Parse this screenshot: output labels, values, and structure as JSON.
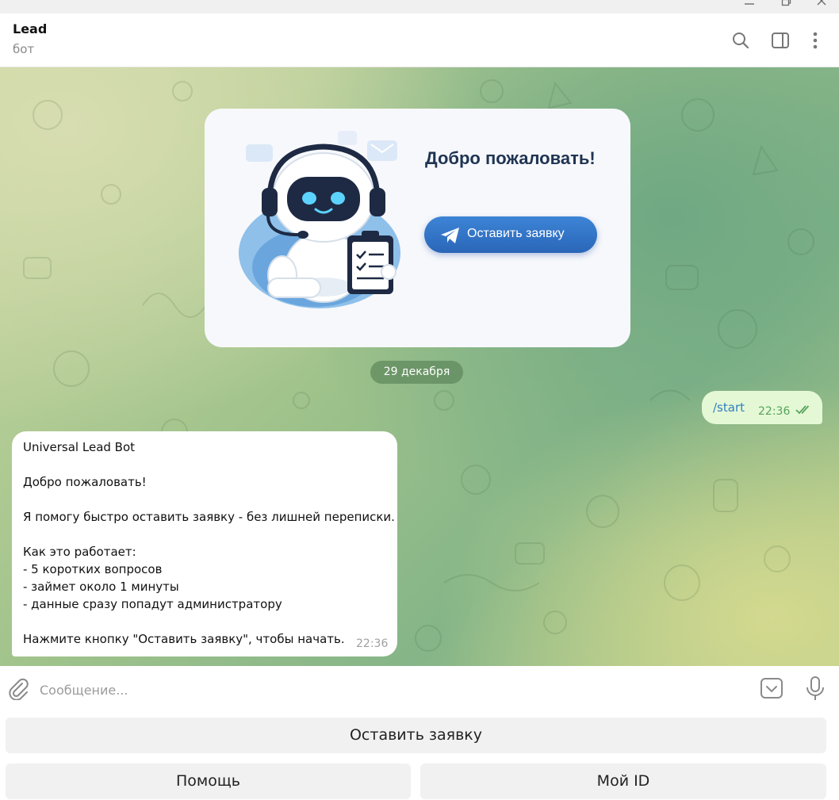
{
  "window": {
    "controls": [
      "minimize",
      "restore",
      "close"
    ]
  },
  "header": {
    "title": "Lead",
    "subtitle": "бот",
    "icons": [
      "search-icon",
      "sidebar-toggle-icon",
      "more-vert-icon"
    ]
  },
  "welcome_card": {
    "title": "Добро пожаловать!",
    "button_label": "Оставить заявку",
    "button_icon": "telegram-plane-icon"
  },
  "date_separator": "29 декабря",
  "outgoing_message": {
    "text": "/start",
    "time": "22:36",
    "status": "read"
  },
  "incoming_message": {
    "text": "Universal Lead Bot\n\nДобро пожаловать!\n\nЯ помогу быстро оставить заявку - без лишней переписки.\n\nКак это работает:\n- 5 коротких вопросов\n- займет около 1 минуты\n- данные сразу попадут администратору\n\nНажмите кнопку \"Оставить заявку\", чтобы начать.",
    "time": "22:36"
  },
  "composer": {
    "placeholder": "Сообщение...",
    "icons": [
      "paperclip-icon",
      "keyboard-toggle-icon",
      "microphone-icon"
    ]
  },
  "keyboard": {
    "row1": [
      "Оставить заявку"
    ],
    "row2": [
      "Помощь",
      "Мой ID"
    ]
  },
  "colors": {
    "outgoing_bubble": "#e5f8d6",
    "incoming_bubble": "#ffffff",
    "accent_blue": "#2a66b8",
    "read_check": "#55a35b"
  }
}
